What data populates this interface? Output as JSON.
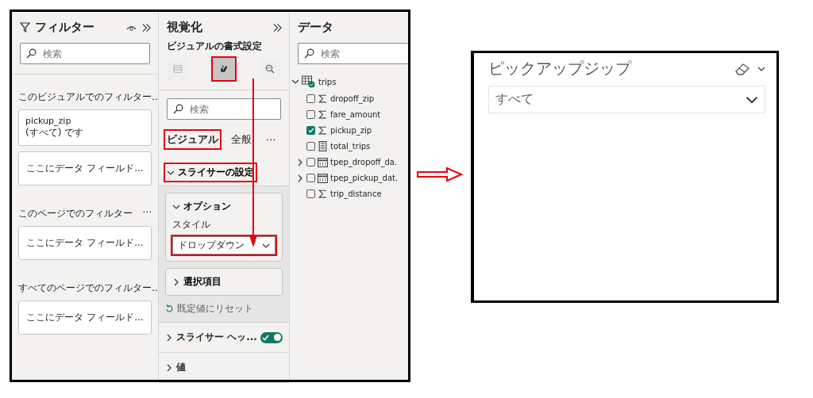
{
  "filters": {
    "title": "フィルター",
    "search": {
      "placeholder": "検索"
    },
    "sections": [
      {
        "title": "このビジュアルでのフィルター…",
        "cards": [
          {
            "kind": "filter",
            "field": "pickup_zip",
            "value": "(すべて) です"
          },
          {
            "kind": "drop",
            "text": "ここにデータ フィールド..."
          }
        ]
      },
      {
        "title": "このページでのフィルター",
        "menu": "···",
        "cards": [
          {
            "kind": "drop",
            "text": "ここにデータ フィールド..."
          }
        ]
      },
      {
        "title": "すべてのページでのフィルター…",
        "cards": [
          {
            "kind": "drop",
            "text": "ここにデータ フィールド..."
          }
        ]
      }
    ]
  },
  "visualizations": {
    "title": "視覚化",
    "subtitle": "ビジュアルの書式設定",
    "icons": [
      {
        "kind": "build",
        "selected": false,
        "highlighted": false
      },
      {
        "kind": "format",
        "selected": true,
        "highlighted": true
      },
      {
        "kind": "analytics",
        "selected": false,
        "highlighted": false
      }
    ],
    "search": {
      "placeholder": "検索"
    },
    "tabs": [
      {
        "label": "ビジュアル",
        "selected": true,
        "highlighted": true
      },
      {
        "label": "全般",
        "selected": false,
        "highlighted": false
      }
    ],
    "more": "···",
    "section": {
      "label": "スライサーの設定",
      "expanded": true,
      "highlighted": true,
      "cards": [
        {
          "label": "オプション",
          "expanded": true,
          "field_label": "スタイル",
          "dropdown": {
            "value": "ドロップダウン",
            "highlighted": true
          }
        },
        {
          "label": "選択項目",
          "expanded": false
        }
      ],
      "reset": "既定値にリセット"
    },
    "rows": [
      {
        "label": "スライサー ヘッ...",
        "expanded": false,
        "toggle": {
          "on": true
        }
      },
      {
        "label": "値",
        "expanded": false
      }
    ]
  },
  "data": {
    "title": "データ",
    "search": {
      "placeholder": "検索"
    },
    "tree": [
      {
        "label": "trips",
        "kind": "table",
        "expanded": true,
        "children": [
          {
            "label": "dropoff_zip",
            "kind": "sum",
            "checked": false
          },
          {
            "label": "fare_amount",
            "kind": "sum",
            "checked": false
          },
          {
            "label": "pickup_zip",
            "kind": "sum",
            "checked": true
          },
          {
            "label": "total_trips",
            "kind": "measure",
            "checked": false
          },
          {
            "label": "tpep_dropoff_da.",
            "kind": "date",
            "checked": false,
            "expanded": false
          },
          {
            "label": "tpep_pickup_dat.",
            "kind": "date",
            "checked": false,
            "expanded": false
          },
          {
            "label": "trip_distance",
            "kind": "sum",
            "checked": false
          }
        ]
      }
    ]
  },
  "slicer": {
    "title": "ピックアップジップ",
    "dropdown": {
      "value": "すべて"
    }
  }
}
